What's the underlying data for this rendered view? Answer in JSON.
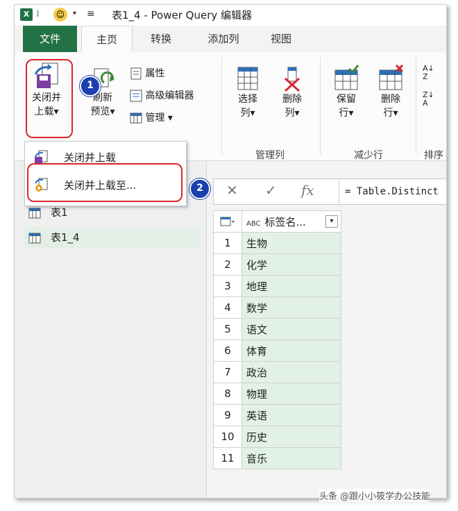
{
  "window": {
    "title": "表1_4 - Power Query 编辑器",
    "app_icon": "X",
    "accent_color": "#217346"
  },
  "tabs": [
    {
      "label": "文件"
    },
    {
      "label": "主页"
    },
    {
      "label": "转换"
    },
    {
      "label": "添加列"
    },
    {
      "label": "视图"
    }
  ],
  "ribbon": {
    "close_load": {
      "line1": "关闭并",
      "line2": "上载",
      "caret": "▾"
    },
    "refresh": {
      "line1": "刷新",
      "line2": "预览",
      "caret": "▾"
    },
    "properties": "属性",
    "advanced_editor": "高级编辑器",
    "manage": "管理",
    "manage_caret": "▾",
    "choose_cols": {
      "line1": "选择",
      "line2": "列",
      "caret": "▾"
    },
    "remove_cols": {
      "line1": "删除",
      "line2": "列",
      "caret": "▾"
    },
    "keep_rows": {
      "line1": "保留",
      "line2": "行",
      "caret": "▾"
    },
    "remove_rows": {
      "line1": "删除",
      "line2": "行",
      "caret": "▾"
    },
    "group_manage_cols": "管理列",
    "group_reduce_rows": "减少行",
    "group_sort": "排序"
  },
  "dropdown_menu": {
    "items": [
      {
        "label": "关闭并上载"
      },
      {
        "label": "关闭并上载至..."
      }
    ]
  },
  "callouts": [
    "1",
    "2"
  ],
  "queries": [
    {
      "label": "表1"
    },
    {
      "label": "表1_4"
    }
  ],
  "formula_bar": {
    "cancel": "✕",
    "confirm": "✓",
    "fx": "fx",
    "formula": "= Table.Distinct"
  },
  "grid": {
    "column_type": "ABC",
    "column_header": "标签名...",
    "rows": [
      {
        "index": "1",
        "value": "生物"
      },
      {
        "index": "2",
        "value": "化学"
      },
      {
        "index": "3",
        "value": "地理"
      },
      {
        "index": "4",
        "value": "数学"
      },
      {
        "index": "5",
        "value": "语文"
      },
      {
        "index": "6",
        "value": "体育"
      },
      {
        "index": "7",
        "value": "政治"
      },
      {
        "index": "8",
        "value": "物理"
      },
      {
        "index": "9",
        "value": "英语"
      },
      {
        "index": "10",
        "value": "历史"
      },
      {
        "index": "11",
        "value": "音乐"
      }
    ]
  },
  "watermark": "头条 @跟小小筱学办公技能"
}
